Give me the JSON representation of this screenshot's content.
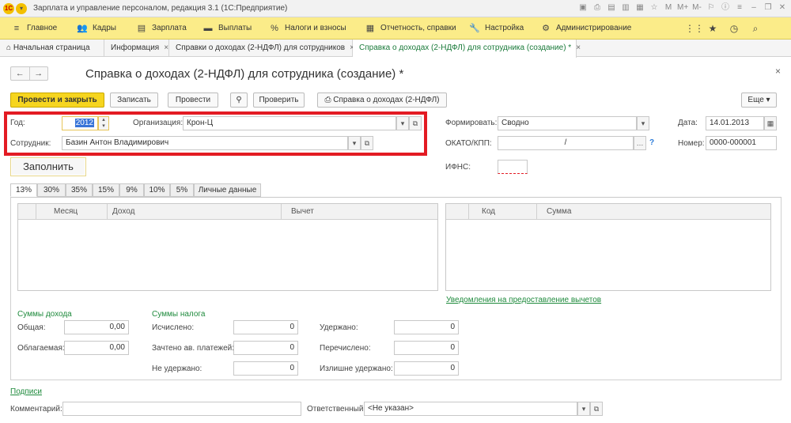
{
  "titlebar": {
    "logo": "1С",
    "title": "Зарплата и управление персоналом, редакция 3.1  (1С:Предприятие)",
    "icons": [
      "save-icon",
      "print-icon",
      "download-icon",
      "upload-icon",
      "calendar-icon",
      "star-icon",
      "m-icon",
      "m-plus-icon",
      "m-minus-icon",
      "user-icon",
      "info-icon",
      "menu-icon",
      "minimize-icon",
      "restore-icon",
      "close-icon"
    ],
    "glyphs": [
      "▣",
      "⎙",
      "▤",
      "▥",
      "▦",
      "☆",
      "M",
      "M+",
      "M-",
      "⚐",
      "ⓘ",
      "≡",
      "–",
      "❐",
      "✕"
    ]
  },
  "menu": {
    "items": [
      {
        "icon": "≡",
        "label": "Главное"
      },
      {
        "icon": "👥",
        "label": "Кадры"
      },
      {
        "icon": "▤",
        "label": "Зарплата"
      },
      {
        "icon": "▬",
        "label": "Выплаты"
      },
      {
        "icon": "%",
        "label": "Налоги и взносы"
      },
      {
        "icon": "▦",
        "label": "Отчетность, справки"
      },
      {
        "icon": "🔧",
        "label": "Настройка"
      },
      {
        "icon": "⚙",
        "label": "Администрирование"
      }
    ],
    "right_icons": [
      "⋮⋮",
      "★",
      "◷",
      "⌕"
    ]
  },
  "tabs": [
    {
      "label": "Начальная страница",
      "closable": false,
      "icon": "⌂"
    },
    {
      "label": "Информация",
      "closable": true
    },
    {
      "label": "Справки о доходах (2-НДФЛ) для сотрудников",
      "closable": true
    },
    {
      "label": "Справка о доходах (2-НДФЛ) для сотрудника (создание) *",
      "closable": true
    }
  ],
  "form": {
    "title": "Справка о доходах (2-НДФЛ) для сотрудника (создание) *",
    "nav_back": "←",
    "nav_forward": "→",
    "close": "×",
    "buttons": {
      "post_close": "Провести и закрыть",
      "save": "Записать",
      "post": "Провести",
      "attach": "⚲",
      "check": "Проверить",
      "print": "Справка о доходах (2-НДФЛ)",
      "more": "Еще ▾"
    },
    "year_label": "Год:",
    "year_value": "2012",
    "org_label": "Организация:",
    "org_value": "Крон-Ц",
    "employee_label": "Сотрудник:",
    "employee_value": "Базин Антон Владимирович",
    "fill_button": "Заполнить",
    "form_label": "Формировать:",
    "form_value": "Сводно",
    "date_label": "Дата:",
    "date_value": "14.01.2013",
    "okato_label": "ОКАТО/КПП:",
    "okato_value": "/",
    "number_label": "Номер:",
    "number_value": "0000-000001",
    "ifns_label": "ИФНС:",
    "question": "?"
  },
  "rate_tabs": [
    "13%",
    "30%",
    "35%",
    "15%",
    "9%",
    "10%",
    "5%",
    "Личные данные"
  ],
  "income_grid": {
    "columns": [
      "Месяц",
      "Доход",
      "Вычет"
    ]
  },
  "deduction_grid": {
    "columns": [
      "Код",
      "Сумма"
    ]
  },
  "deduction_link": "Уведомления на предоставление вычетов",
  "income_totals": {
    "title": "Суммы дохода",
    "total_label": "Общая:",
    "total_value": "0,00",
    "taxable_label": "Облагаемая:",
    "taxable_value": "0,00"
  },
  "tax_totals": {
    "title": "Суммы налога",
    "calc_label": "Исчислено:",
    "calc_value": "0",
    "credited_label": "Зачтено ав. платежей:",
    "credited_value": "0",
    "not_withheld_label": "Не удержано:",
    "not_withheld_value": "0",
    "withheld_label": "Удержано:",
    "withheld_value": "0",
    "transferred_label": "Перечислено:",
    "transferred_value": "0",
    "over_withheld_label": "Излишне удержано:",
    "over_withheld_value": "0"
  },
  "footer": {
    "signatures_link": "Подписи",
    "comment_label": "Комментарий:",
    "comment_value": "",
    "responsible_label": "Ответственный:",
    "responsible_value": "<Не указан>"
  }
}
